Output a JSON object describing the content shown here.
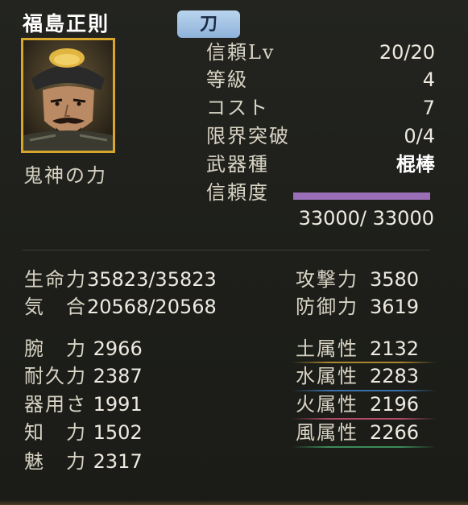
{
  "character": {
    "name": "福島正則",
    "weapon_tab": "刀",
    "skill_name": "鬼神の力"
  },
  "info": {
    "trust_level_label": "信頼Lv",
    "trust_level_value": "20/20",
    "rank_label": "等級",
    "rank_value": "4",
    "cost_label": "コスト",
    "cost_value": "7",
    "limit_break_label": "限界突破",
    "limit_break_value": "0/4",
    "weapon_type_label": "武器種",
    "weapon_type_value": "棍棒",
    "trust_label": "信頼度",
    "trust_points": "33000/ 33000",
    "trust_fraction": 1.0
  },
  "stats": {
    "hp_label": "生命力",
    "hp_value": "35823/35823",
    "ki_label": "気　合",
    "ki_value": "20568/20568",
    "atk_label": "攻撃力",
    "atk_value": "3580",
    "def_label": "防御力",
    "def_value": "3619",
    "str_label": "腕　力",
    "str_value": "2966",
    "end_label": "耐久力",
    "end_value": "2387",
    "dex_label": "器用さ",
    "dex_value": "1991",
    "int_label": "知　力",
    "int_value": "1502",
    "cha_label": "魅　力",
    "cha_value": "2317"
  },
  "attributes": {
    "earth_label": "土属性",
    "earth_value": "2132",
    "water_label": "水属性",
    "water_value": "2283",
    "fire_label": "火属性",
    "fire_value": "2196",
    "wind_label": "風属性",
    "wind_value": "2266",
    "colors": {
      "earth": "#a8882e",
      "water": "#3a6fa8",
      "fire": "#b04a6a",
      "wind": "#3c8a5a"
    }
  },
  "colors": {
    "weapon_tab": "#9fc0e2",
    "portrait_frame": "#d7a62d",
    "trust_bar": "#9a6fb8"
  }
}
